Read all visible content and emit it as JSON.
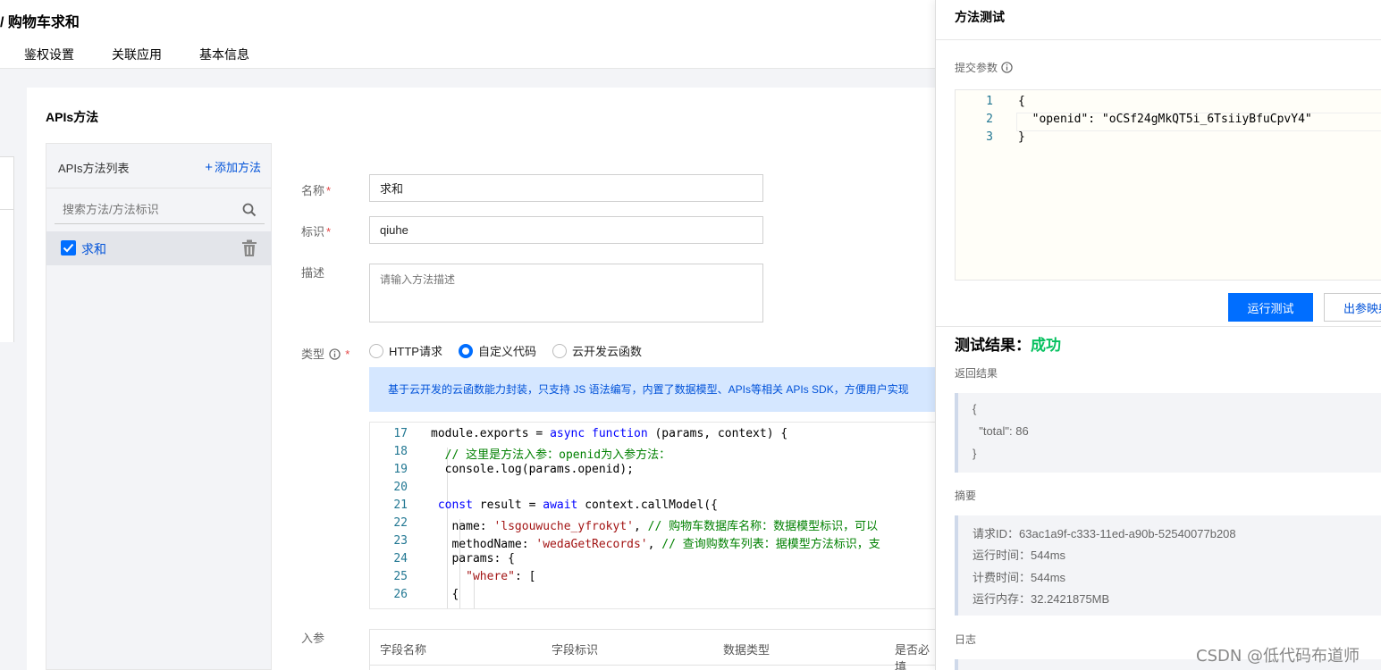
{
  "header": {
    "title": "/ 购物车求和",
    "tabs": [
      "鉴权设置",
      "关联应用",
      "基本信息"
    ]
  },
  "card": {
    "title": "APIs方法",
    "list": {
      "title": "APIs方法列表",
      "add_label": "添加方法",
      "add_icon": "+",
      "search_placeholder": "搜索方法/方法标识",
      "items": [
        {
          "label": "求和",
          "checked": true
        }
      ]
    },
    "form": {
      "name_label": "名称",
      "name_value": "求和",
      "id_label": "标识",
      "id_value": "qiuhe",
      "desc_label": "描述",
      "desc_placeholder": "请输入方法描述",
      "type_label": "类型",
      "required_mark": "*",
      "types": [
        "HTTP请求",
        "自定义代码",
        "云开发云函数"
      ],
      "selected_type": "自定义代码",
      "banner": "基于云开发的云函数能力封装，只支持 JS 语法编写，内置了数据模型、APIs等相关 APIs SDK，方便用户实现",
      "params_label": "入参",
      "params_columns": [
        "字段名称",
        "字段标识",
        "数据类型",
        "是否必填"
      ]
    },
    "code_lines": [
      {
        "num": "17",
        "text": "module.exports = async function (params, context) {"
      },
      {
        "num": "18",
        "text": "  // 这里是方法入参：openid为入参方法："
      },
      {
        "num": "19",
        "text": "  console.log(params.openid);"
      },
      {
        "num": "20",
        "text": ""
      },
      {
        "num": "21",
        "text": " const result = await context.callModel({"
      },
      {
        "num": "22",
        "text": "   name: 'lsgouwuche_yfrokyt', // 购物车数据库名称：数据模型标识，可以"
      },
      {
        "num": "23",
        "text": "   methodName: 'wedaGetRecords', // 查询购数车列表：据模型方法标识，支"
      },
      {
        "num": "24",
        "text": "   params: {"
      },
      {
        "num": "25",
        "text": "     \"where\": ["
      },
      {
        "num": "26",
        "text": "   {"
      }
    ]
  },
  "test_panel": {
    "title": "方法测试",
    "submit_label": "提交参数",
    "json_lines": [
      {
        "num": "1",
        "text": "{"
      },
      {
        "num": "2",
        "text": "  \"openid\": \"oCSf24gMkQT5i_6TsiiyBfuCpvY4\""
      },
      {
        "num": "3",
        "text": "}"
      }
    ],
    "run_button": "运行测试",
    "mapping_button": "出参映射",
    "result_title": "测试结果：",
    "result_status": "成功",
    "return_label": "返回结果",
    "return_lines": [
      "{",
      "  \"total\": 86",
      "}"
    ],
    "summary_label": "摘要",
    "summary_lines": [
      "请求ID：63ac1a9f-c333-11ed-a90b-52540077b208",
      "运行时间：544ms",
      "计费时间：544ms",
      "运行内存：32.2421875MB"
    ],
    "log_label": "日志"
  },
  "watermark": "CSDN @低代码布道师",
  "colors": {
    "accent": "#006eff",
    "success": "#07c160",
    "link": "#0052d9"
  }
}
